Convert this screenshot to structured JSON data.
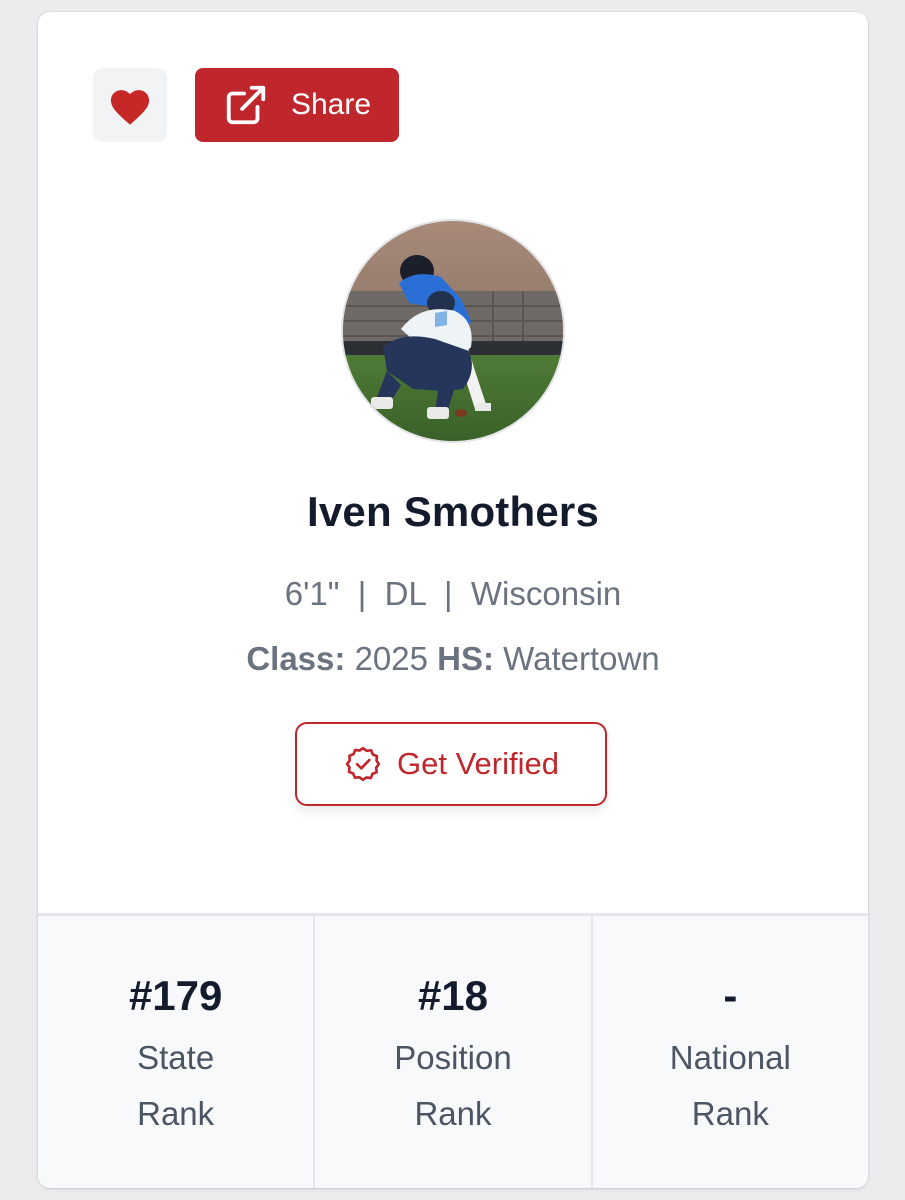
{
  "actions": {
    "favorite_icon": "heart-icon",
    "share_icon": "external-link-icon",
    "share_label": "Share"
  },
  "profile": {
    "name": "Iven Smothers",
    "height": "6'1\"",
    "position": "DL",
    "state": "Wisconsin",
    "meta_line": "6'1\"  |  DL  |  Wisconsin",
    "class_label": "Class:",
    "class_value": "2025",
    "hs_label": "HS:",
    "hs_value": "Watertown"
  },
  "verify": {
    "icon": "verified-badge-icon",
    "label": "Get Verified"
  },
  "stats": [
    {
      "value": "#179",
      "label": "State Rank"
    },
    {
      "value": "#18",
      "label": "Position Rank"
    },
    {
      "value": "-",
      "label": "National Rank"
    }
  ],
  "colors": {
    "brand_red": "#c0272d",
    "heart_red": "#c62828",
    "text_dark": "#141b2d",
    "text_muted": "#6b7280"
  }
}
